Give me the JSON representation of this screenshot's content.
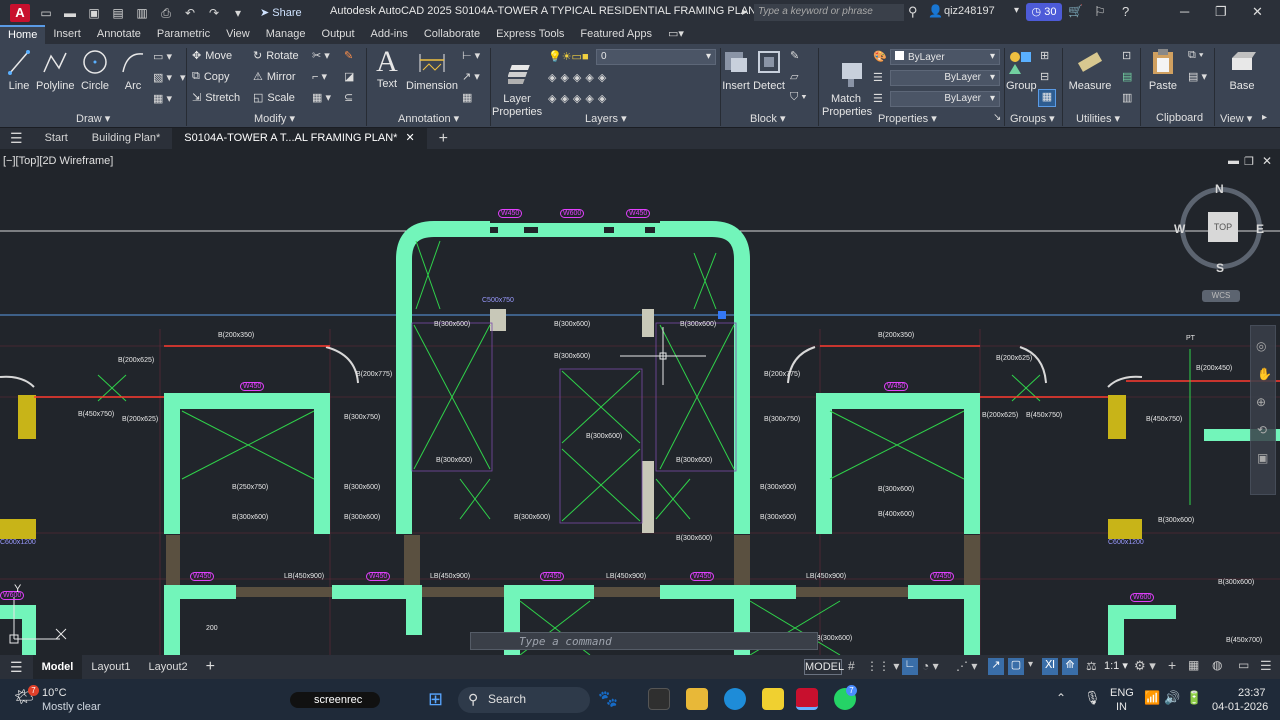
{
  "titlebar": {
    "logo": "A",
    "share_label": "Share",
    "title": "Autodesk AutoCAD 2025   S0104A-TOWER A TYPICAL RESIDENTIAL FRAMING PLAN.dwg",
    "search_placeholder": "Type a keyword or phrase",
    "user": "qiz248197",
    "timer_badge": "30"
  },
  "ribbon_tabs": [
    "Home",
    "Insert",
    "Annotate",
    "Parametric",
    "View",
    "Manage",
    "Output",
    "Add-ins",
    "Collaborate",
    "Express Tools",
    "Featured Apps"
  ],
  "ribbon": {
    "draw": {
      "title": "Draw",
      "line": "Line",
      "polyline": "Polyline",
      "circle": "Circle",
      "arc": "Arc"
    },
    "modify": {
      "title": "Modify",
      "move": "Move",
      "rotate": "Rotate",
      "copy": "Copy",
      "mirror": "Mirror",
      "stretch": "Stretch",
      "scale": "Scale"
    },
    "annotation": {
      "title": "Annotation",
      "text": "Text",
      "dimension": "Dimension"
    },
    "layers": {
      "title": "Layers",
      "layer_properties": "Layer\nProperties",
      "current_layer": "0"
    },
    "block": {
      "title": "Block",
      "insert": "Insert",
      "detect": "Detect"
    },
    "properties": {
      "title": "Properties",
      "match": "Match\nProperties",
      "color": "ByLayer",
      "linetype": "ByLayer",
      "lineweight": "ByLayer"
    },
    "groups": {
      "title": "Groups",
      "group": "Group"
    },
    "utilities": {
      "title": "Utilities",
      "measure": "Measure"
    },
    "clipboard": {
      "title": "Clipboard",
      "paste": "Paste"
    },
    "view": {
      "title": "View",
      "base": "Base"
    }
  },
  "file_tabs": {
    "start": "Start",
    "building": "Building Plan*",
    "active": "S0104A-TOWER A T...AL FRAMING PLAN*"
  },
  "viewport": {
    "label": "[−][Top][2D Wireframe]",
    "viewcube": {
      "n": "N",
      "s": "S",
      "e": "E",
      "w": "W",
      "top": "TOP",
      "wcs": "WCS"
    },
    "ucs_y": "Y",
    "command_placeholder": "Type a command",
    "labels": {
      "w450": "W450",
      "w600": "W600",
      "b300x600": "B(300x600)",
      "b200x350": "B(200x350)",
      "b200x775": "B(200x775)",
      "b200x625": "B(200x625)",
      "b450x750": "B(450x750)",
      "b300x750": "B(300x750)",
      "b250x750": "B(250x750)",
      "b400x600": "B(400x600)",
      "b200x600": "B(200x600)",
      "c500x750": "C500x750",
      "c600x1200": "C600x1200",
      "c600x1540": "C600x1540",
      "lb450x900": "LB(450x900)",
      "lb600x600": "LB(600x600)",
      "b450x700": "B(450x700)",
      "n200": "200",
      "pt": "PT",
      "b400x600v": "B(400x600)",
      "b200x450": "B(200x450)"
    }
  },
  "layout_tabs": [
    "Model",
    "Layout1",
    "Layout2"
  ],
  "status": {
    "model": "MODEL",
    "scale": "1:1"
  },
  "taskbar": {
    "weather_temp": "10°C",
    "weather_desc": "Mostly clear",
    "screenrec": "screenrec",
    "search": "Search",
    "lang": "ENG",
    "region": "IN",
    "time": "23:37",
    "date": "04-01-2026"
  },
  "colors": {
    "wall": "#72f5ba",
    "beam": "#ff3b30",
    "label": "#e040fb",
    "accent": "#5a9be6"
  }
}
